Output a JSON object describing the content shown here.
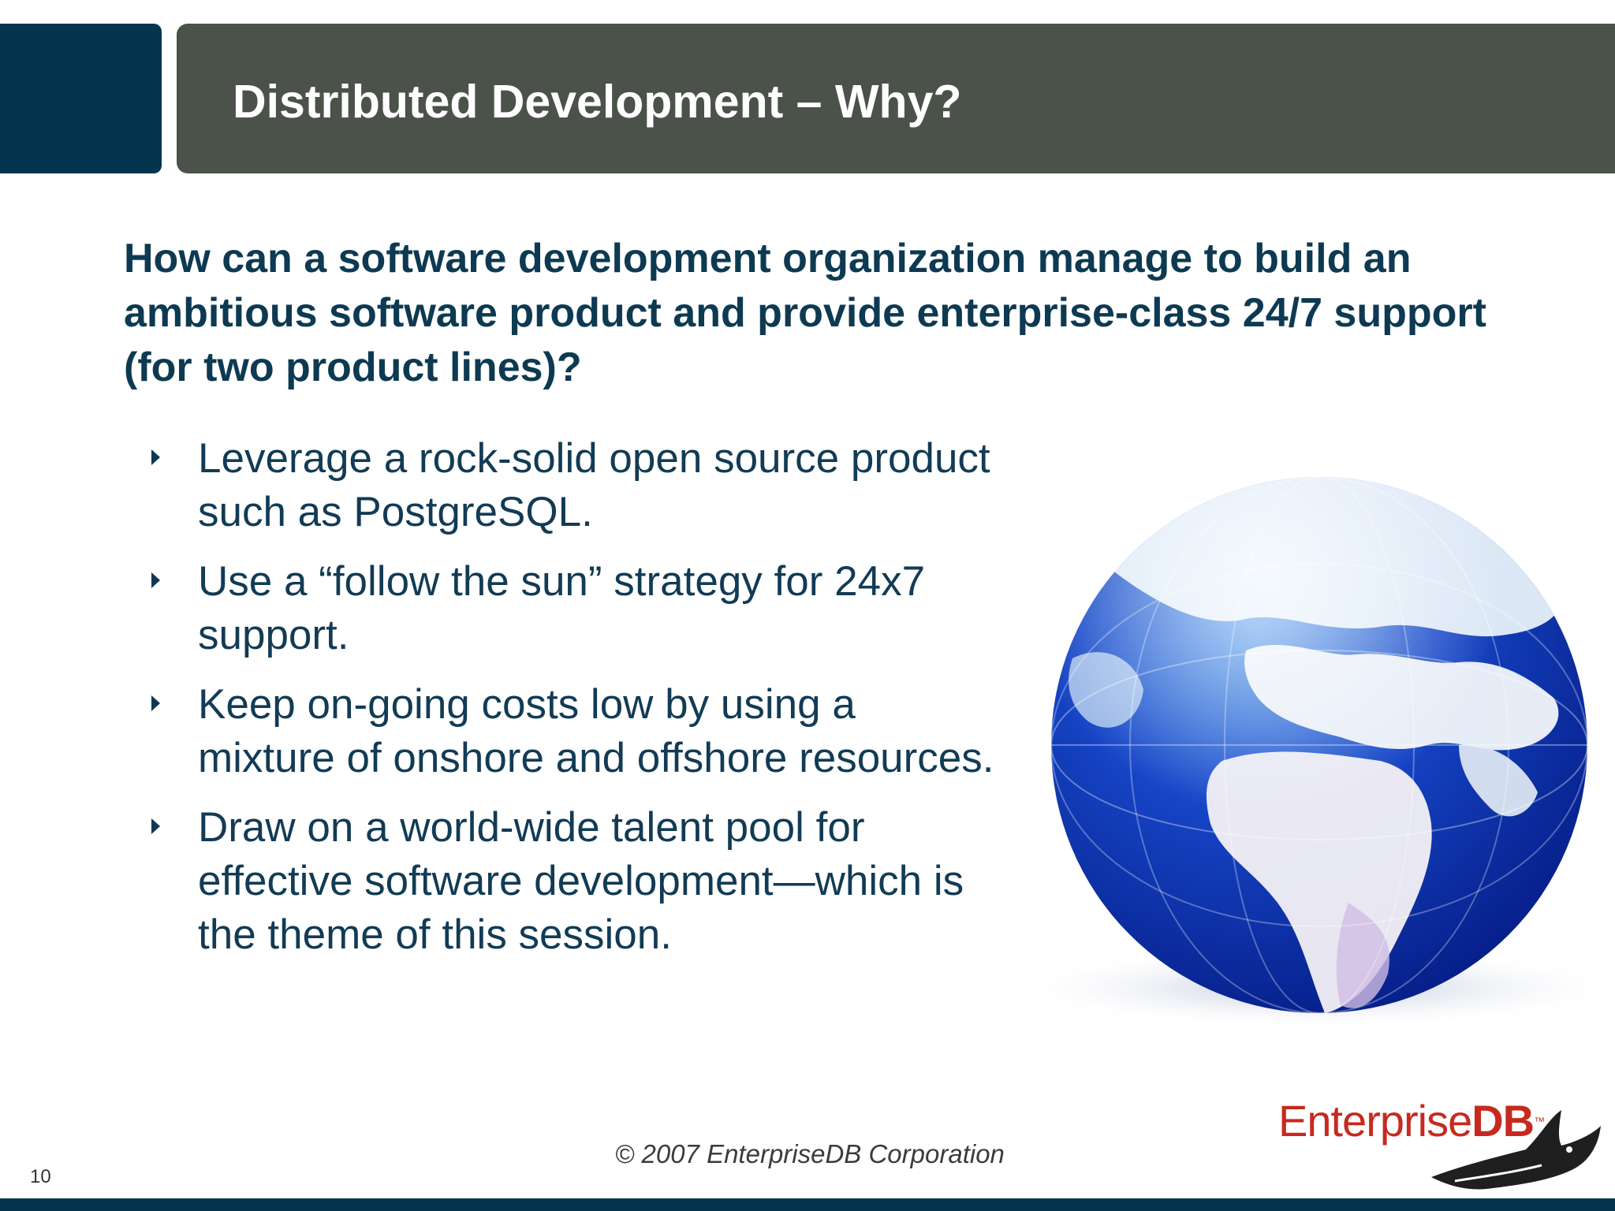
{
  "slide": {
    "title": "Distributed Development – Why?",
    "subheading": "How can a software development organization manage to build an ambitious software product and provide enterprise-class 24/7 support (for two product lines)?",
    "bullets": [
      "Leverage a rock-solid open source product such as PostgreSQL.",
      "Use a “follow the sun” strategy for 24x7 support.",
      "Keep on-going costs low by using a mixture of onshore and offshore resources.",
      "Draw on a world-wide talent pool for effective software development—which is the theme of this session."
    ]
  },
  "footer": {
    "copyright": "© 2007 EnterpriseDB Corporation",
    "page_number": "10"
  },
  "logo": {
    "word_main": "Enterprise",
    "word_accent": "DB",
    "trademark": "™"
  },
  "colors": {
    "navy": "#04354f",
    "header_gray": "#4a5249",
    "text_navy": "#123b55",
    "logo_red": "#c62a1f"
  },
  "icons": {
    "bullet": "right-triangle-icon",
    "globe": "globe-illustration",
    "logo_mascot": "shark-icon"
  }
}
